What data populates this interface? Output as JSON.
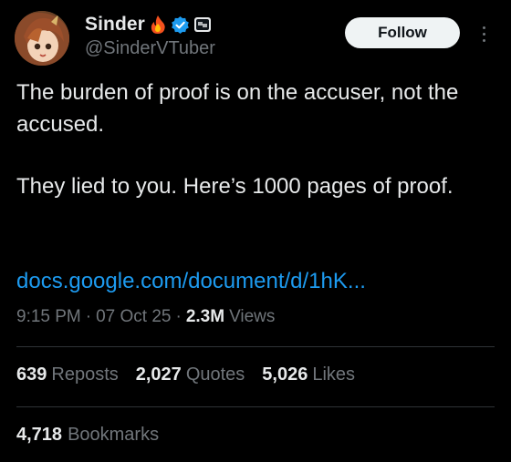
{
  "author": {
    "display_name": "Sinder",
    "handle": "@SinderVTuber",
    "badges": [
      "fire-emoji",
      "verified-icon",
      "affiliate-icon"
    ]
  },
  "actions": {
    "follow_label": "Follow",
    "more_icon": "more-options-icon"
  },
  "tweet": {
    "line1": "The burden of proof is on the accuser, not the accused.",
    "line2": "They lied to you. Here’s 1000 pages of proof.",
    "link": "docs.google.com/document/d/1hK..."
  },
  "meta": {
    "time": "9:15 PM",
    "sep1": "·",
    "date": "07 Oct 25",
    "sep2": "·",
    "views_count": "2.3M",
    "views_label": "Views"
  },
  "stats": {
    "reposts_count": "639",
    "reposts_label": "Reposts",
    "quotes_count": "2,027",
    "quotes_label": "Quotes",
    "likes_count": "5,026",
    "likes_label": "Likes",
    "bookmarks_count": "4,718",
    "bookmarks_label": "Bookmarks"
  },
  "colors": {
    "background": "#000000",
    "text": "#e7e9ea",
    "muted": "#71767b",
    "link": "#1d9bf0",
    "verified": "#1d9bf0",
    "divider": "#2f3336"
  }
}
